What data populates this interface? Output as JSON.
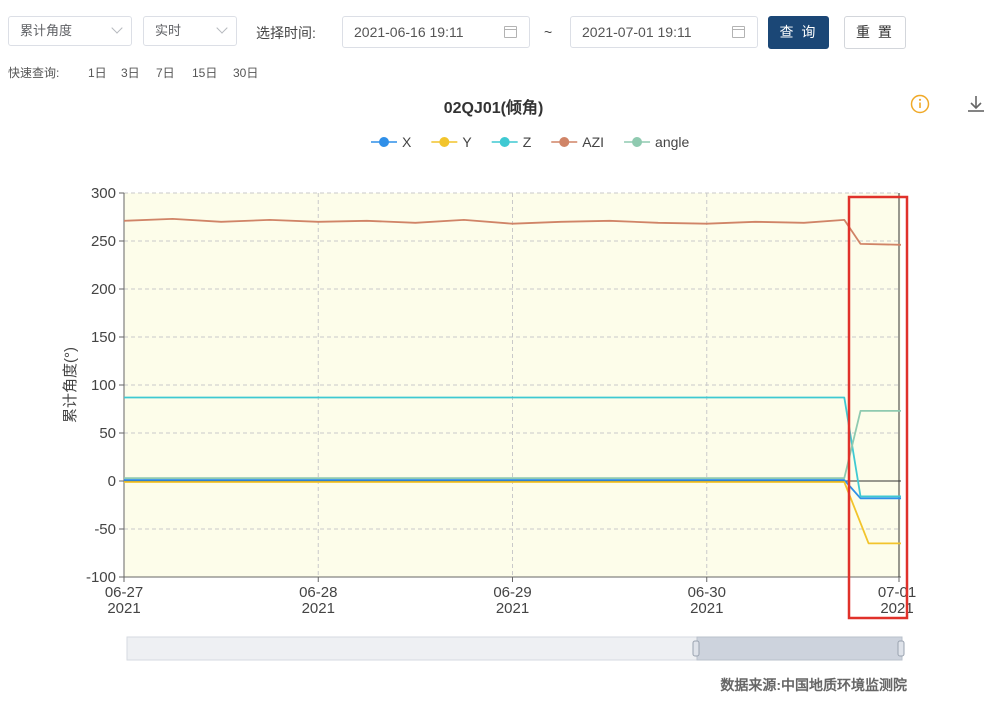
{
  "toolbar": {
    "type_select": "累计角度",
    "mode_select": "实时",
    "time_label": "选择时间:",
    "start_date": "2021-06-16 19:11",
    "separator": "~",
    "end_date": "2021-07-01 19:11",
    "query_button": "查 询",
    "reset_button": "重 置"
  },
  "quick_query": {
    "label": "快速查询:",
    "options": [
      "1日",
      "3日",
      "7日",
      "15日",
      "30日"
    ]
  },
  "chart_title": "02QJ01(倾角)",
  "source_text": "数据来源:中国地质环境监测院",
  "colors": {
    "primary_button": "#1b4776",
    "highlight_box": "#e0312a",
    "plot_background": "#fdfdea",
    "info_icon": "#f0a928"
  },
  "chart_data": {
    "type": "line",
    "ylabel": "累计角度(°)",
    "ylim": [
      -100,
      300
    ],
    "yticks": [
      "300",
      "250",
      "200",
      "150",
      "100",
      "50",
      "0",
      "-50",
      "-100"
    ],
    "xticks": [
      {
        "date": "06-27",
        "year": "2021"
      },
      {
        "date": "06-28",
        "year": "2021"
      },
      {
        "date": "06-29",
        "year": "2021"
      },
      {
        "date": "06-30",
        "year": "2021"
      },
      {
        "date": "07-01",
        "year": "2021"
      }
    ],
    "x_range": [
      "2021-06-27 00:00",
      "2021-07-01 00:00"
    ],
    "grid": true,
    "legend_position": "top-center",
    "series": [
      {
        "name": "X",
        "color": "#2f8fe8",
        "x": [
          "2021-06-27 00:00",
          "2021-06-30 17:00",
          "2021-06-30 19:00",
          "2021-07-01 00:00"
        ],
        "y": [
          1,
          1,
          -18,
          -18
        ]
      },
      {
        "name": "Y",
        "color": "#f2c42c",
        "x": [
          "2021-06-27 00:00",
          "2021-06-30 17:00",
          "2021-06-30 20:00",
          "2021-07-01 00:00"
        ],
        "y": [
          -1,
          -1,
          -65,
          -65
        ]
      },
      {
        "name": "Z",
        "color": "#3fc9d2",
        "x": [
          "2021-06-27 00:00",
          "2021-06-30 17:00",
          "2021-06-30 19:00",
          "2021-07-01 00:00"
        ],
        "y": [
          87,
          87,
          -16,
          -16
        ]
      },
      {
        "name": "AZI",
        "color": "#d08467",
        "x": [
          "2021-06-27 00:00",
          "2021-06-27 06:00",
          "2021-06-27 12:00",
          "2021-06-27 18:00",
          "2021-06-28 00:00",
          "2021-06-28 06:00",
          "2021-06-28 12:00",
          "2021-06-28 18:00",
          "2021-06-29 00:00",
          "2021-06-29 06:00",
          "2021-06-29 12:00",
          "2021-06-29 18:00",
          "2021-06-30 00:00",
          "2021-06-30 06:00",
          "2021-06-30 12:00",
          "2021-06-30 17:00",
          "2021-06-30 19:00",
          "2021-07-01 00:00"
        ],
        "y": [
          271,
          273,
          270,
          272,
          270,
          271,
          269,
          272,
          268,
          270,
          271,
          269,
          268,
          270,
          269,
          272,
          247,
          246
        ]
      },
      {
        "name": "angle",
        "color": "#8fcab0",
        "x": [
          "2021-06-27 00:00",
          "2021-06-30 17:00",
          "2021-06-30 19:00",
          "2021-07-01 00:00"
        ],
        "y": [
          3,
          3,
          73,
          73
        ]
      }
    ]
  }
}
